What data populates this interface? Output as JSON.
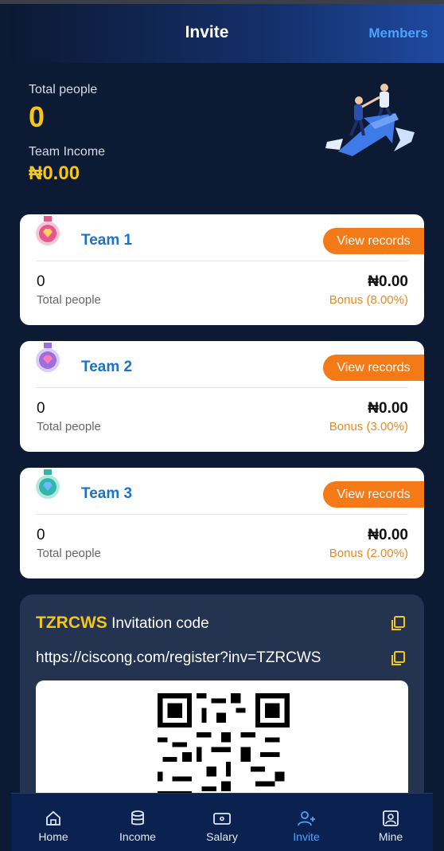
{
  "header": {
    "title": "Invite",
    "members_label": "Members"
  },
  "stats": {
    "total_people_label": "Total people",
    "total_people_value": "0",
    "team_income_label": "Team Income",
    "team_income_value": "₦0.00"
  },
  "teams": [
    {
      "name": "Team 1",
      "button": "View records",
      "people": "0",
      "people_label": "Total people",
      "amount": "₦0.00",
      "bonus": "Bonus (8.00%)",
      "medal_color": "#e8568f"
    },
    {
      "name": "Team 2",
      "button": "View records",
      "people": "0",
      "people_label": "Total people",
      "amount": "₦0.00",
      "bonus": "Bonus (3.00%)",
      "medal_color": "#9a6fe0"
    },
    {
      "name": "Team 3",
      "button": "View records",
      "people": "0",
      "people_label": "Total people",
      "amount": "₦0.00",
      "bonus": "Bonus (2.00%)",
      "medal_color": "#2fb7a8"
    }
  ],
  "invite": {
    "code": "TZRCWS",
    "code_label": "Invitation code",
    "url": "https://ciscong.com/register?inv=TZRCWS"
  },
  "tabs": [
    {
      "label": "Home",
      "icon": "home-icon"
    },
    {
      "label": "Income",
      "icon": "database-icon"
    },
    {
      "label": "Salary",
      "icon": "wallet-icon"
    },
    {
      "label": "Invite",
      "icon": "add-user-icon",
      "active": true
    },
    {
      "label": "Mine",
      "icon": "profile-icon"
    }
  ],
  "colors": {
    "accent_gold": "#f5c518",
    "button_orange": "#f47a18",
    "link_blue": "#4aa3ff",
    "team_blue": "#1a73c9"
  }
}
